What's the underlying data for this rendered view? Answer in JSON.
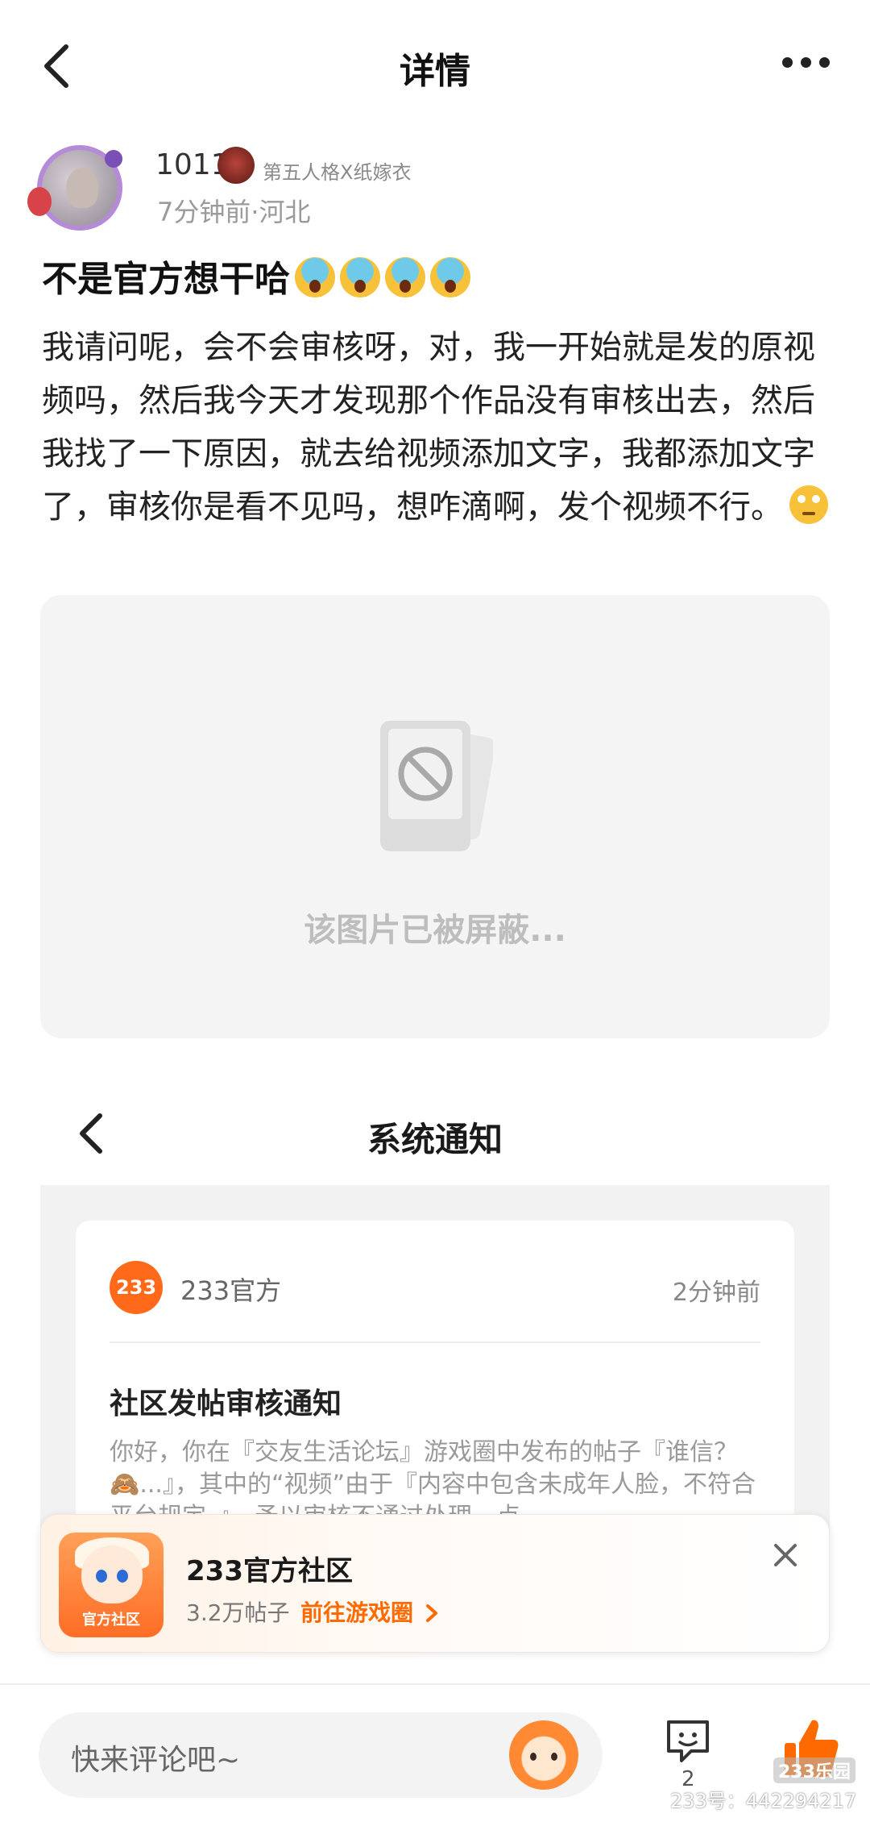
{
  "topbar": {
    "title": "详情"
  },
  "author": {
    "name": "1011",
    "title_badge": "第五人格X纸嫁衣",
    "meta": "7分钟前·河北"
  },
  "post": {
    "title": "不是官方想干哈",
    "body": "我请问呢，会不会审核呀，对，我一开始就是发的原视频吗，然后我今天才发现那个作品没有审核出去，然后我找了一下原因，就去给视频添加文字，我都添加文字了，审核你是看不见吗，想咋滴啊，发个视频不行。",
    "title_emoji_count": 4
  },
  "blocked_image": {
    "text": "该图片已被屏蔽..."
  },
  "notice_screenshot": {
    "title": "系统通知",
    "logo_text": "233",
    "sender": "233官方",
    "time": "2分钟前",
    "heading": "社区发帖审核通知",
    "body": "你好，你在『交友生活论坛』游戏圈中发布的帖子『谁信？🙈...』，其中的“视频”由于『内容中包含未成年人脸，不符合平台规定。』，予以审核不通过处理，点"
  },
  "community": {
    "name": "233官方社区",
    "posts": "3.2万帖子",
    "go_label": "前往游戏圈",
    "icon_label": "官方社区"
  },
  "bottom_bar": {
    "comment_placeholder": "快来评论吧~",
    "reply_count": "2"
  },
  "watermark": {
    "logo": "233乐园",
    "id": "233号：442294217"
  },
  "colors": {
    "accent": "#ff6a00",
    "logo_orange": "#ff6a1a",
    "blocked_bg": "#f4f4f5"
  }
}
